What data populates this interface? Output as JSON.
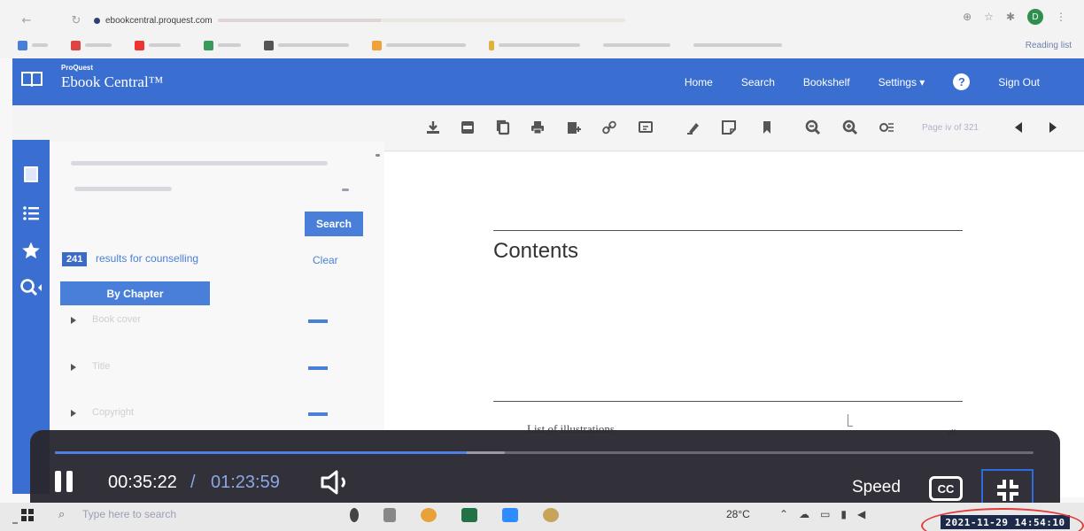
{
  "browser": {
    "address_host": "ebookcentral.proquest.com",
    "avatar_letter": "D",
    "reading_list_label": "Reading list"
  },
  "app": {
    "brand_small": "ProQuest",
    "brand": "Ebook Central™",
    "nav": {
      "home": "Home",
      "search": "Search",
      "bookshelf": "Bookshelf",
      "settings": "Settings ▾",
      "help": "?",
      "sign_out": "Sign Out"
    },
    "colors": {
      "brand_blue": "#3a6ed0",
      "button_blue": "#4a7fd9",
      "player_bg": "#2a2830",
      "progress_blue": "#4f7fe0"
    }
  },
  "toolbar": {
    "icons": [
      "download-icon",
      "pdf-icon",
      "copy-icon",
      "print-icon",
      "add-to-bookshelf-icon",
      "link-icon",
      "citation-icon",
      "highlight-icon",
      "note-icon",
      "bookmark-icon",
      "zoom-out-icon",
      "zoom-in-icon",
      "page-settings-icon"
    ],
    "page_indicator": "Page iv of 321"
  },
  "search_panel": {
    "search_button": "Search",
    "result_count": "241",
    "results_text": "results for counselling",
    "clear_link": "Clear",
    "by_chapter_button": "By Chapter",
    "chapters": [
      {
        "label": "Book cover"
      },
      {
        "label": "Title"
      },
      {
        "label": "Copyright"
      }
    ]
  },
  "document": {
    "heading": "Contents",
    "first_entry": "List of illustrations",
    "first_entry_page": "vii"
  },
  "player": {
    "current_time": "00:35:22",
    "separator": "/",
    "duration": "01:23:59",
    "played_fraction": 0.421,
    "buffered_fraction": 0.46,
    "speed_label": "Speed",
    "cc_label": "CC"
  },
  "taskbar": {
    "search_placeholder": "Type here to search",
    "weather": "28°C",
    "datetime": "2021-11-29 14:54:10"
  }
}
